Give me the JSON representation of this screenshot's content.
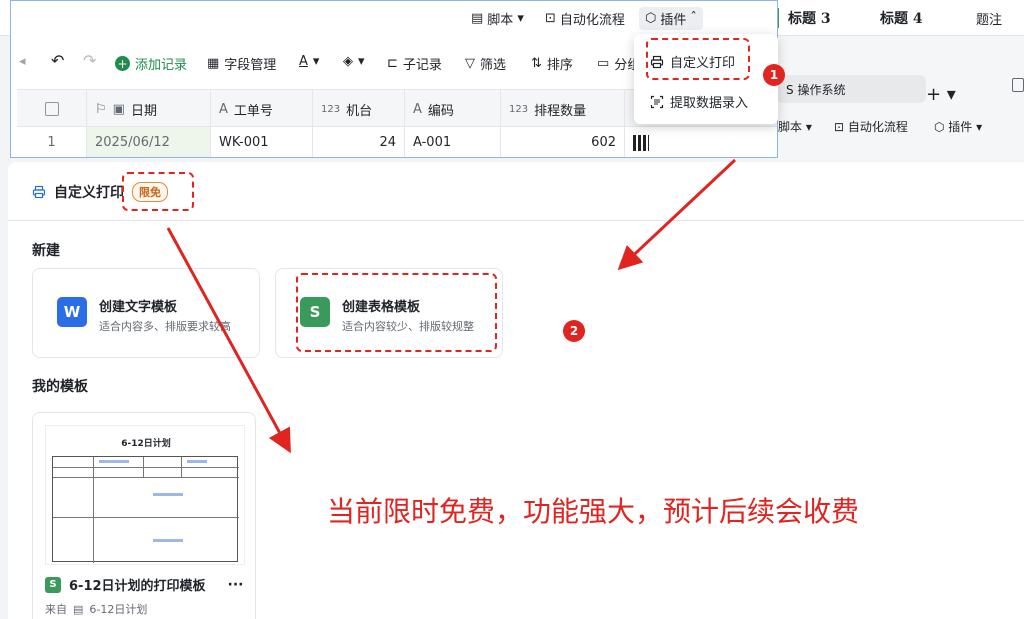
{
  "background": {
    "top_menu": {
      "script": "脚本",
      "automation": "自动化流程",
      "plugins": "插件"
    },
    "headings": [
      "标题 3",
      "标题 4"
    ],
    "caption": "题注",
    "tab": "操作系统",
    "toolbar": {
      "script": "脚本",
      "automation": "自动化流程",
      "plugins": "插件"
    }
  },
  "toolbar": {
    "add_record": "添加记录",
    "field_manage": "字段管理",
    "sub_record": "子记录",
    "filter": "筛选",
    "sort": "排序",
    "group": "分组"
  },
  "table": {
    "columns": [
      "日期",
      "工单号",
      "机台",
      "编码",
      "排程数量"
    ],
    "column_type_badges": {
      "number": "123"
    },
    "rows": [
      {
        "index": "1",
        "date": "2025/06/12",
        "order": "WK-001",
        "machine": "24",
        "code": "A-001",
        "qty": "602"
      }
    ]
  },
  "dropdown": {
    "items": [
      "自定义打印",
      "提取数据录入"
    ]
  },
  "panel": {
    "title": "自定义打印",
    "badge": "限免",
    "new_section": "新建",
    "cards": [
      {
        "icon_letter": "W",
        "title": "创建文字模板",
        "subtitle": "适合内容多、排版要求较高"
      },
      {
        "icon_letter": "S",
        "title": "创建表格模板",
        "subtitle": "适合内容较少、排版较规整"
      }
    ],
    "my_templates": "我的模板",
    "template": {
      "thumb_title": "6-12日计划",
      "name": "6-12日计划的打印模板",
      "more": "···",
      "from_label": "来自",
      "from_source": "6-12日计划"
    }
  },
  "annotations": {
    "step1": "1",
    "step2": "2",
    "note": "当前限时免费，功能强大，预计后续会收费"
  },
  "colors": {
    "accent_red": "#e0241f",
    "green": "#1f8b4c",
    "word_blue": "#2b6de5",
    "sheet_green": "#3a9a5b"
  }
}
